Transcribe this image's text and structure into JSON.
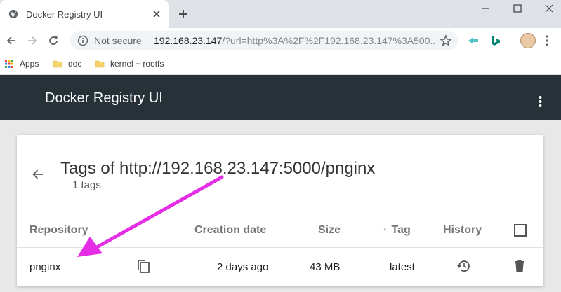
{
  "browser": {
    "tab_title": "Docker Registry UI",
    "omnibox": {
      "security_label": "Not secure",
      "url_host": "192.168.23.147",
      "url_rest": "/?url=http%3A%2F%2F192.168.23.147%3A500..."
    },
    "bookmarks": [
      {
        "label": "Apps",
        "icon": "apps-grid-icon"
      },
      {
        "label": "doc",
        "icon": "folder-icon"
      },
      {
        "label": "kernel + rootfs",
        "icon": "folder-icon"
      }
    ]
  },
  "app": {
    "title": "Docker Registry UI"
  },
  "page": {
    "title": "Tags of http://192.168.23.147:5000/pnginx",
    "subtitle": "1 tags",
    "table": {
      "columns": {
        "repository": "Repository",
        "creation_date": "Creation date",
        "size": "Size",
        "tag": "Tag",
        "history": "History"
      },
      "sort_indicator": "↑",
      "rows": [
        {
          "repository": "pnginx",
          "creation_date": "2 days ago",
          "size": "43 MB",
          "tag": "latest"
        }
      ]
    }
  },
  "colors": {
    "appbar": "#263238",
    "annotation_arrow": "#e52de6"
  }
}
